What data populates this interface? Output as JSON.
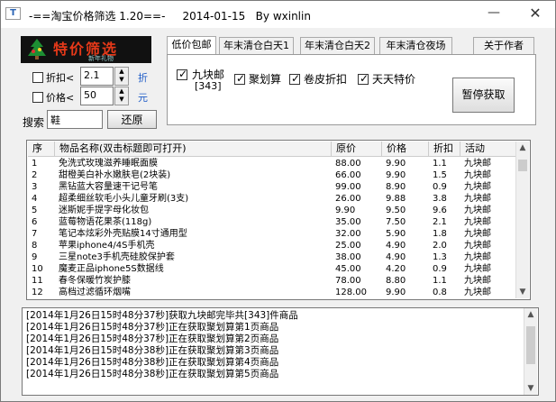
{
  "window": {
    "title": "-==淘宝价格筛选 1.20==-     2014-01-15   By wxinlin",
    "icon": "app-icon",
    "min": "—",
    "close": "✕"
  },
  "logo": {
    "main": "特价筛选",
    "sub": "新年礼物"
  },
  "filters": {
    "discount_label": "折扣<",
    "discount_value": "2.1",
    "discount_unit": "折",
    "price_label": "价格<",
    "price_value": "50",
    "price_unit": "元",
    "search_label": "搜索",
    "search_value": "鞋",
    "restore_button": "还原"
  },
  "tabs": [
    "低价包邮",
    "年末清仓白天1",
    "年末清仓白天2",
    "年末清仓夜场",
    "关于作者"
  ],
  "options": {
    "jiukuai": "九块邮",
    "jiukuai_count": "[343]",
    "juhuasuan": "聚划算",
    "juanpi": "卷皮折扣",
    "tiantian": "天天特价",
    "stop_button": "暂停获取"
  },
  "table": {
    "headers": [
      "序",
      "物品名称(双击标题即可打开)",
      "原价",
      "价格",
      "折扣",
      "活动"
    ],
    "rows": [
      [
        "1",
        "免洗式玫瑰滋养睡眠面膜",
        "88.00",
        "9.90",
        "1.1",
        "九块邮"
      ],
      [
        "2",
        "甜橙美白补水嫩肤皂(2块装)",
        "66.00",
        "9.90",
        "1.5",
        "九块邮"
      ],
      [
        "3",
        "黑钻蓝大容量速干记号笔",
        "99.00",
        "8.90",
        "0.9",
        "九块邮"
      ],
      [
        "4",
        "超柔细丝软毛小头儿童牙刷(3支)",
        "26.00",
        "9.88",
        "3.8",
        "九块邮"
      ],
      [
        "5",
        "迷斯妮手提字母化妆包",
        "9.90",
        "9.50",
        "9.6",
        "九块邮"
      ],
      [
        "6",
        "蓝莓物语花果茶(118g)",
        "35.00",
        "7.50",
        "2.1",
        "九块邮"
      ],
      [
        "7",
        "笔记本炫彩外壳贴膜14寸通用型",
        "32.00",
        "5.90",
        "1.8",
        "九块邮"
      ],
      [
        "8",
        "苹果iphone4/4S手机壳",
        "25.00",
        "4.90",
        "2.0",
        "九块邮"
      ],
      [
        "9",
        "三星note3手机壳硅胶保护套",
        "38.00",
        "4.90",
        "1.3",
        "九块邮"
      ],
      [
        "10",
        "魔麦正品iphone5S数据线",
        "45.00",
        "4.20",
        "0.9",
        "九块邮"
      ],
      [
        "11",
        "春冬保暖竹炭护膝",
        "78.00",
        "8.80",
        "1.1",
        "九块邮"
      ],
      [
        "12",
        "高档过滤循环烟嘴",
        "128.00",
        "9.90",
        "0.8",
        "九块邮"
      ]
    ]
  },
  "log": [
    "[2014年1月26日15时48分37秒]获取九块邮完毕共[343]件商品",
    "[2014年1月26日15时48分37秒]正在获取聚划算第1页商品",
    "[2014年1月26日15时48分37秒]正在获取聚划算第2页商品",
    "[2014年1月26日15时48分38秒]正在获取聚划算第3页商品",
    "[2014年1月26日15时48分38秒]正在获取聚划算第4页商品",
    "[2014年1月26日15时48分38秒]正在获取聚划算第5页商品"
  ]
}
